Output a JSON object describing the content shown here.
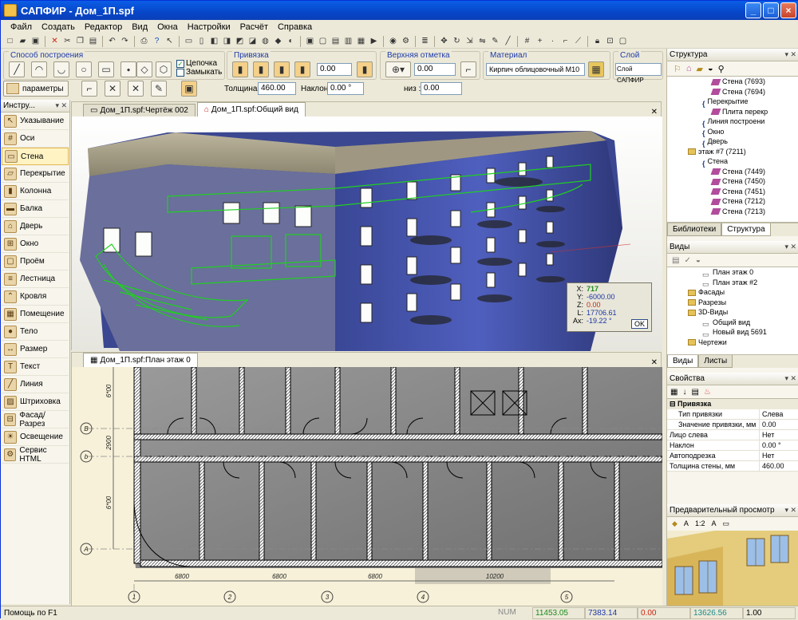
{
  "window": {
    "title": "САПФИР - Дом_1П.spf",
    "controls": [
      "_",
      "□",
      "×"
    ]
  },
  "menu": [
    "Файл",
    "Создать",
    "Редактор",
    "Вид",
    "Окна",
    "Настройки",
    "Расчёт",
    "Справка"
  ],
  "props": {
    "method_label": "Способ построения",
    "chain_label": "Цепочка",
    "close_label": "Замыкать",
    "snap_label": "Привязка",
    "snap_value": "0.00",
    "top_mark_label": "Верхняя отметка",
    "top_mark_value": "0.00",
    "material_label": "Материал",
    "material_value": "Кирпич облицовочный М10",
    "layer_label": "Слой",
    "layer_value": "Слой САПФИР",
    "params_button": "параметры",
    "thickness_label": "Толщина :",
    "thickness_value": "460.00",
    "tilt_label": "Наклон :",
    "tilt_value": "0.00 °",
    "bottom_label": "низ :",
    "bottom_value": "0.00"
  },
  "tools": {
    "header": "Инстру...",
    "items": [
      {
        "label": "Указывание",
        "icon": "pointer-icon",
        "glyph": "↖"
      },
      {
        "label": "Оси",
        "icon": "axes-icon",
        "glyph": "#"
      },
      {
        "label": "Стена",
        "icon": "wall-icon",
        "glyph": "▭"
      },
      {
        "label": "Перекрытие",
        "icon": "slab-icon",
        "glyph": "▱"
      },
      {
        "label": "Колонна",
        "icon": "column-icon",
        "glyph": "▮"
      },
      {
        "label": "Балка",
        "icon": "beam-icon",
        "glyph": "▬"
      },
      {
        "label": "Дверь",
        "icon": "door-icon",
        "glyph": "⌂"
      },
      {
        "label": "Окно",
        "icon": "window-icon",
        "glyph": "⊞"
      },
      {
        "label": "Проём",
        "icon": "opening-icon",
        "glyph": "▢"
      },
      {
        "label": "Лестница",
        "icon": "stairs-icon",
        "glyph": "≡"
      },
      {
        "label": "Кровля",
        "icon": "roof-icon",
        "glyph": "⌃"
      },
      {
        "label": "Помещение",
        "icon": "room-icon",
        "glyph": "▦"
      },
      {
        "label": "Тело",
        "icon": "body-icon",
        "glyph": "●"
      },
      {
        "label": "Размер",
        "icon": "dimension-icon",
        "glyph": "↔"
      },
      {
        "label": "Текст",
        "icon": "text-icon",
        "glyph": "T"
      },
      {
        "label": "Линия",
        "icon": "line-icon",
        "glyph": "╱"
      },
      {
        "label": "Штриховка",
        "icon": "hatch-icon",
        "glyph": "▨"
      },
      {
        "label": "Фасад/Разрез",
        "icon": "section-icon",
        "glyph": "⊟"
      },
      {
        "label": "Освещение",
        "icon": "light-icon",
        "glyph": "☀"
      },
      {
        "label": "Сервис HTML",
        "icon": "html-service-icon",
        "glyph": "⚙"
      }
    ]
  },
  "view3d": {
    "tabs": [
      "Дом_1П.spf:Чертёж 002",
      "Дом_1П.spf:Общий вид"
    ],
    "coords": [
      {
        "k": "X:",
        "v": "717"
      },
      {
        "k": "Y:",
        "v": "-6000.00"
      },
      {
        "k": "Z:",
        "v": "0.00"
      },
      {
        "k": "L:",
        "v": "17706.61"
      },
      {
        "k": "Ax:",
        "v": "-19.22 °"
      }
    ],
    "ok": "OK"
  },
  "view2d": {
    "tab": "Дом_1П.spf:План этаж 0",
    "dims": [
      "6800",
      "6800",
      "6800",
      "10200"
    ],
    "axes_numbers": [
      "1",
      "2",
      "3",
      "4",
      "5"
    ],
    "axes_letters": [
      "B",
      "b",
      "A"
    ],
    "vdims": [
      "6*00",
      "2900",
      "6*00"
    ]
  },
  "structure": {
    "header": "Структура",
    "items": [
      {
        "t": "Стена (7693)",
        "lvl": 4,
        "ic": "w"
      },
      {
        "t": "Стена (7694)",
        "lvl": 4,
        "ic": "w"
      },
      {
        "t": "Перекрытие",
        "lvl": 3,
        "ic": "b"
      },
      {
        "t": "Плита перекр",
        "lvl": 4,
        "ic": "w"
      },
      {
        "t": "Линия построени",
        "lvl": 3,
        "ic": "b"
      },
      {
        "t": "Окно",
        "lvl": 3,
        "ic": "b"
      },
      {
        "t": "Дверь",
        "lvl": 3,
        "ic": "b"
      },
      {
        "t": "этаж #7 (7211)",
        "lvl": 2,
        "ic": "f"
      },
      {
        "t": "Стена",
        "lvl": 3,
        "ic": "b"
      },
      {
        "t": "Стена (7449)",
        "lvl": 4,
        "ic": "w"
      },
      {
        "t": "Стена (7450)",
        "lvl": 4,
        "ic": "w"
      },
      {
        "t": "Стена (7451)",
        "lvl": 4,
        "ic": "w"
      },
      {
        "t": "Стена (7212)",
        "lvl": 4,
        "ic": "w"
      },
      {
        "t": "Стена (7213)",
        "lvl": 4,
        "ic": "w"
      }
    ],
    "tabs": [
      "Библиотеки",
      "Структура"
    ]
  },
  "views": {
    "header": "Виды",
    "items": [
      {
        "t": "План этаж 0",
        "lvl": 3
      },
      {
        "t": "План этаж #2",
        "lvl": 3
      },
      {
        "t": "Фасады",
        "lvl": 2
      },
      {
        "t": "Разрезы",
        "lvl": 2
      },
      {
        "t": "3D-Виды",
        "lvl": 2
      },
      {
        "t": "Общий вид",
        "lvl": 3
      },
      {
        "t": "Новый вид 5691",
        "lvl": 3
      },
      {
        "t": "Чертежи",
        "lvl": 2
      }
    ],
    "tabs": [
      "Виды",
      "Листы"
    ]
  },
  "properties": {
    "header": "Свойства",
    "group": "Привязка",
    "rows": [
      {
        "k": "Тип привязки",
        "v": "Слева",
        "indent": true
      },
      {
        "k": "Значение привязки, мм",
        "v": "0.00",
        "indent": true
      },
      {
        "k": "Лицо слева",
        "v": "Нет",
        "indent": false
      },
      {
        "k": "Наклон",
        "v": "0.00 °",
        "indent": false
      },
      {
        "k": "Автоподрезка",
        "v": "Нет",
        "indent": false
      },
      {
        "k": "Толщина стены, мм",
        "v": "460.00",
        "indent": false
      }
    ]
  },
  "preview": {
    "header": "Предварительный просмотр"
  },
  "status": {
    "help": "Помощь по F1",
    "num": "NUM",
    "x": "11453.05",
    "y": "7383.14",
    "z": "0.00",
    "w": "13626.56",
    "s": "1.00"
  },
  "colors": {
    "accent": "#0a5ee6",
    "building": "#4b5ab2",
    "selection": "#1fd11f"
  }
}
